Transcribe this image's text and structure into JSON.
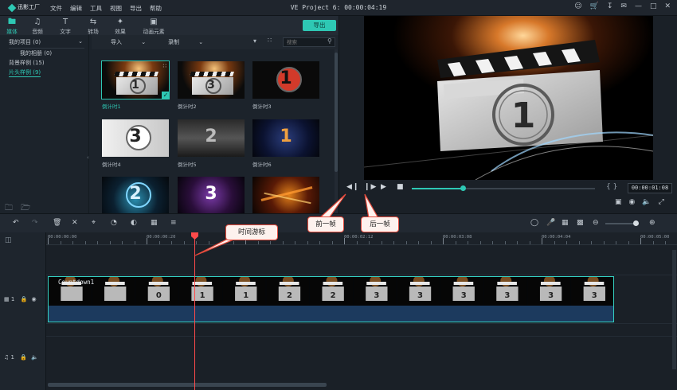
{
  "app": {
    "logo_text": "迅影工厂",
    "menus": [
      "文件",
      "编辑",
      "工具",
      "视图",
      "导出",
      "帮助"
    ],
    "project_title": "VE Project 6: 00:00:04:19",
    "window_icons": [
      "account-icon",
      "cart-icon",
      "download-icon",
      "message-icon",
      "minimize-icon",
      "maximize-icon",
      "close-icon"
    ]
  },
  "tools": [
    {
      "label": "媒体",
      "icon": "folder-icon",
      "active": true
    },
    {
      "label": "音频",
      "icon": "music-note-icon",
      "active": false
    },
    {
      "label": "文字",
      "icon": "text-icon",
      "active": false
    },
    {
      "label": "转场",
      "icon": "transition-icon",
      "active": false
    },
    {
      "label": "效果",
      "icon": "effects-icon",
      "active": false
    },
    {
      "label": "动画元素",
      "icon": "elements-icon",
      "active": false
    }
  ],
  "export_label": "导出",
  "sidebar": {
    "items": [
      {
        "label": "我的项目 (0)",
        "expandable": true
      },
      {
        "label": "我的相册 (0)",
        "indent": true
      },
      {
        "label": "背景样例 (15)"
      },
      {
        "label": "片头样例 (9)",
        "selected": true
      }
    ]
  },
  "filter": {
    "import_label": "导入",
    "record_label": "录制",
    "search_placeholder": "搜索"
  },
  "media": [
    {
      "label": "倒计时1",
      "digit": "1",
      "style": "clap",
      "selected": true
    },
    {
      "label": "倒计时2",
      "digit": "3",
      "style": "clap"
    },
    {
      "label": "倒计时3",
      "digit": "1",
      "style": "red"
    },
    {
      "label": "倒计时4",
      "digit": "3",
      "style": "white"
    },
    {
      "label": "倒计时5",
      "digit": "2",
      "style": "metal"
    },
    {
      "label": "倒计时6",
      "digit": "1",
      "style": "space"
    },
    {
      "label": "",
      "digit": "2",
      "style": "cyan"
    },
    {
      "label": "",
      "digit": "3",
      "style": "purple"
    },
    {
      "label": "",
      "digit": "",
      "style": "fire"
    }
  ],
  "preview": {
    "timecode": "00:00:01:08",
    "braces": "{ }",
    "progress": 0.28
  },
  "timeline": {
    "ruler_labels": [
      "00:00:00:00",
      "00:00:00:20",
      "00:00:01:16",
      "00:00:02:12",
      "00:00:03:08",
      "00:00:04:04",
      "00:00:05:00"
    ],
    "clip_name": "Countdown1",
    "clip_frame_digits": [
      "",
      "",
      "0",
      "1",
      "1",
      "2",
      "2",
      "3",
      "3",
      "3",
      "3",
      "3",
      "3"
    ],
    "video_track_label": "1",
    "audio_track_label": "1",
    "zoom_level": 0.9
  },
  "annotations": {
    "playhead": "时间游标",
    "prev_frame": "前一帧",
    "next_frame": "后一帧"
  },
  "colors": {
    "accent": "#2ec8b4",
    "playhead": "#ff4a4a",
    "callout_border": "#e34a3c"
  }
}
